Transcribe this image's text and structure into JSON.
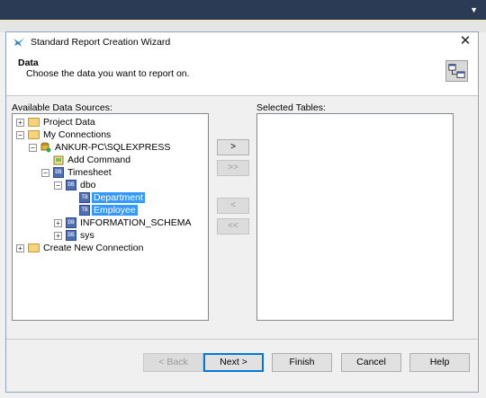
{
  "dialog": {
    "title": "Standard Report Creation Wizard",
    "close": "✕"
  },
  "header": {
    "title": "Data",
    "subtitle": "Choose the data you want to report on."
  },
  "available": {
    "label": "Available Data Sources:",
    "tree": [
      {
        "label": "Project Data",
        "expander": "+",
        "icon": "folder-icon"
      },
      {
        "label": "My Connections",
        "expander": "−",
        "icon": "folder-icon"
      },
      {
        "label": "ANKUR-PC\\SQLEXPRESS",
        "expander": "−",
        "icon": "server-icon"
      },
      {
        "label": "Add Command",
        "expander": "",
        "icon": "command-icon"
      },
      {
        "label": "Timesheet",
        "expander": "−",
        "icon": "database-icon"
      },
      {
        "label": "dbo",
        "expander": "−",
        "icon": "database-icon"
      },
      {
        "label": "Department",
        "expander": "",
        "icon": "table-icon",
        "selected": true
      },
      {
        "label": "Employee",
        "expander": "",
        "icon": "table-icon",
        "selected": true
      },
      {
        "label": "INFORMATION_SCHEMA",
        "expander": "+",
        "icon": "database-icon"
      },
      {
        "label": "sys",
        "expander": "+",
        "icon": "database-icon"
      },
      {
        "label": "Create New Connection",
        "expander": "+",
        "icon": "folder-icon"
      }
    ]
  },
  "selected": {
    "label": "Selected Tables:"
  },
  "move_buttons": {
    "add_one": ">",
    "add_all": ">>",
    "remove_one": "<",
    "remove_all": "<<"
  },
  "buttons": {
    "back": "< Back",
    "next": "Next >",
    "finish": "Finish",
    "cancel": "Cancel",
    "help": "Help"
  },
  "colors": {
    "selection": "#3399ff",
    "default_button_border": "#0078d7",
    "window_bar": "#2b3a55"
  }
}
